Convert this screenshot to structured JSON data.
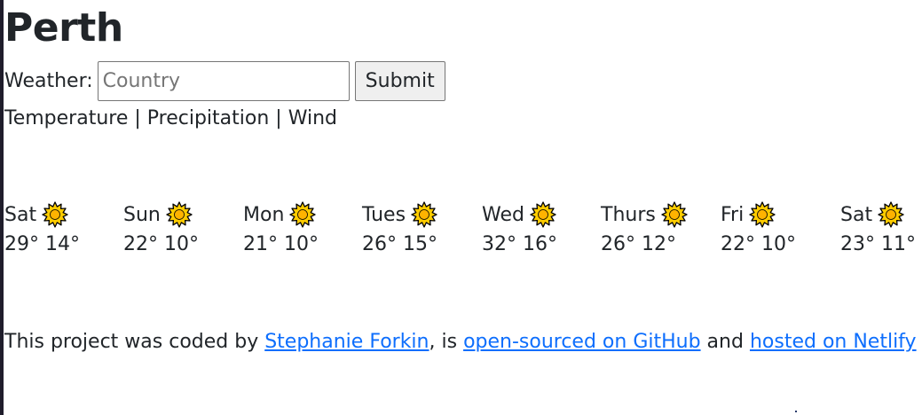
{
  "city": "Perth",
  "search": {
    "label": "Weather:",
    "placeholder": "Country",
    "value": "",
    "submit_label": "Submit"
  },
  "units": {
    "temperature": "Temperature",
    "sep1": " | ",
    "precipitation": "Precipitation",
    "sep2": " | ",
    "wind": "Wind"
  },
  "forecast": [
    {
      "day": "Sat",
      "max": "29°",
      "min": "14°",
      "icon": "sun-icon"
    },
    {
      "day": "Sun",
      "max": "22°",
      "min": "10°",
      "icon": "sun-icon"
    },
    {
      "day": "Mon",
      "max": "21°",
      "min": "10°",
      "icon": "sun-icon"
    },
    {
      "day": "Tues",
      "max": "26°",
      "min": "15°",
      "icon": "sun-icon"
    },
    {
      "day": "Wed",
      "max": "32°",
      "min": "16°",
      "icon": "sun-icon"
    },
    {
      "day": "Thurs",
      "max": "26°",
      "min": "12°",
      "icon": "sun-icon"
    },
    {
      "day": "Fri",
      "max": "22°",
      "min": "10°",
      "icon": "sun-icon"
    },
    {
      "day": "Sat",
      "max": "23°",
      "min": "11°",
      "icon": "sun-icon"
    }
  ],
  "footer": {
    "prefix": "This project was coded by ",
    "author": "Stephanie Forkin",
    "mid1": ", is ",
    "repo_link": "open-sourced on GitHub",
    "mid2": " and ",
    "host_link": "hosted on Netlify"
  },
  "colors": {
    "link": "#0d6efd",
    "sun_fill": "#ffcc00",
    "sun_outline": "#000000"
  }
}
